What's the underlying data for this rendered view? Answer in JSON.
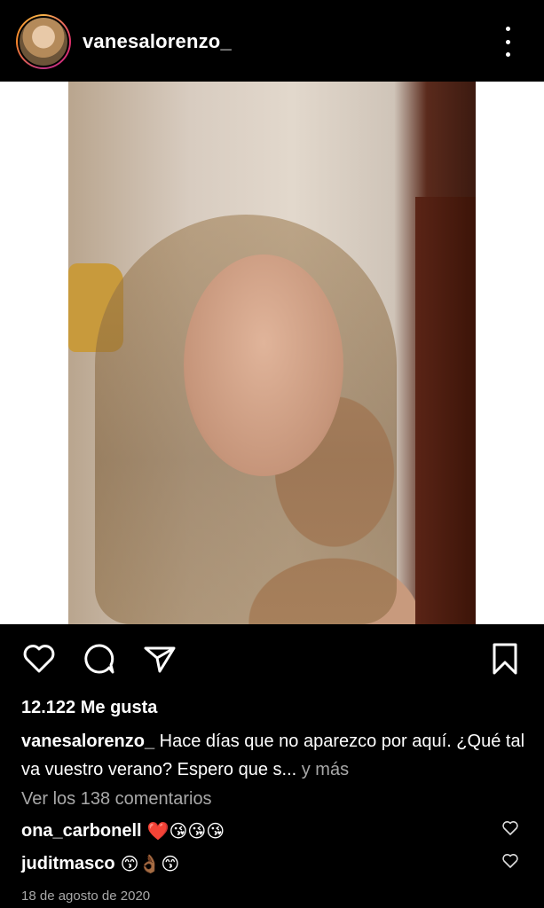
{
  "post": {
    "username": "vanesalorenzo_",
    "likes": "12.122 Me gusta",
    "caption_user": "vanesalorenzo_",
    "caption_text": "Hace días que no aparezco por aquí. ¿Qué tal va vuestro verano? Espero que s...",
    "caption_more": " y más",
    "view_comments": "Ver los 138 comentarios",
    "comments": [
      {
        "user": "ona_carbonell",
        "text": "❤️😘😘😘"
      },
      {
        "user": "juditmasco",
        "text": "😙👌🏾😙"
      }
    ],
    "date": "18 de agosto de 2020"
  },
  "icons": {
    "header_more": "more-vertical-icon",
    "like": "heart-icon",
    "comment": "comment-icon",
    "share": "send-icon",
    "save": "bookmark-icon"
  }
}
